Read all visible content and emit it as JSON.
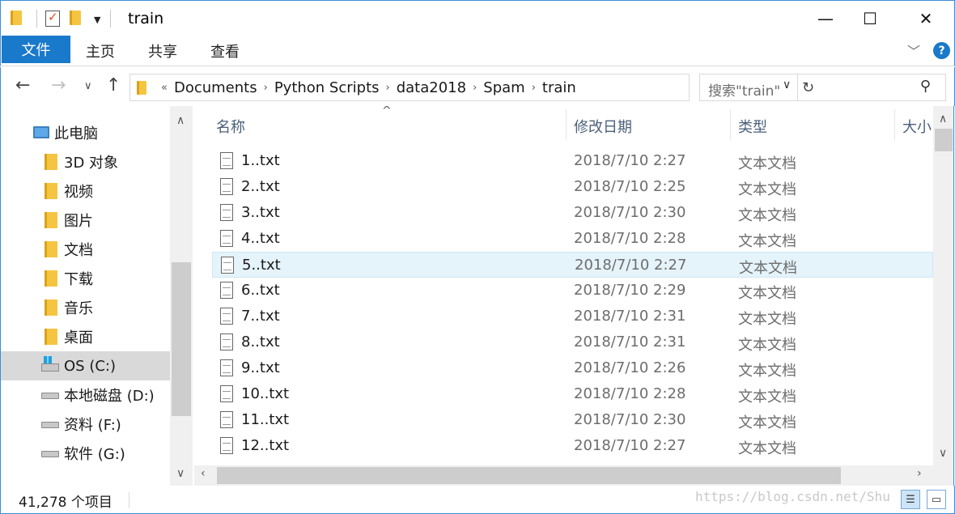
{
  "window": {
    "title": "train",
    "minimize": "—",
    "maximize": "☐",
    "close": "✕"
  },
  "ribbon": {
    "tabs": [
      "文件",
      "主页",
      "共享",
      "查看"
    ]
  },
  "address": {
    "overflow": "«",
    "crumbs": [
      "Documents",
      "Python Scripts",
      "data2018",
      "Spam",
      "train"
    ]
  },
  "search": {
    "placeholder": "搜索\"train\""
  },
  "nav_tree": [
    {
      "label": "此电脑",
      "icon": "computer-icon"
    },
    {
      "label": "3D 对象",
      "icon": "folder-icon"
    },
    {
      "label": "视频",
      "icon": "folder-icon"
    },
    {
      "label": "图片",
      "icon": "folder-icon"
    },
    {
      "label": "文档",
      "icon": "folder-icon"
    },
    {
      "label": "下载",
      "icon": "folder-icon"
    },
    {
      "label": "音乐",
      "icon": "folder-icon"
    },
    {
      "label": "桌面",
      "icon": "folder-icon"
    },
    {
      "label": "OS (C:)",
      "icon": "os-drive-icon",
      "selected": true
    },
    {
      "label": "本地磁盘 (D:)",
      "icon": "drive-icon"
    },
    {
      "label": "资料 (F:)",
      "icon": "drive-icon"
    },
    {
      "label": "软件 (G:)",
      "icon": "drive-icon"
    }
  ],
  "columns": {
    "name": "名称",
    "date": "修改日期",
    "type": "类型",
    "size": "大小"
  },
  "files": [
    {
      "name": "1..txt",
      "date": "2018/7/10 2:27",
      "type": "文本文档"
    },
    {
      "name": "2..txt",
      "date": "2018/7/10 2:25",
      "type": "文本文档"
    },
    {
      "name": "3..txt",
      "date": "2018/7/10 2:30",
      "type": "文本文档"
    },
    {
      "name": "4..txt",
      "date": "2018/7/10 2:28",
      "type": "文本文档"
    },
    {
      "name": "5..txt",
      "date": "2018/7/10 2:27",
      "type": "文本文档",
      "hover": true
    },
    {
      "name": "6..txt",
      "date": "2018/7/10 2:29",
      "type": "文本文档"
    },
    {
      "name": "7..txt",
      "date": "2018/7/10 2:31",
      "type": "文本文档"
    },
    {
      "name": "8..txt",
      "date": "2018/7/10 2:31",
      "type": "文本文档"
    },
    {
      "name": "9..txt",
      "date": "2018/7/10 2:26",
      "type": "文本文档"
    },
    {
      "name": "10..txt",
      "date": "2018/7/10 2:28",
      "type": "文本文档"
    },
    {
      "name": "11..txt",
      "date": "2018/7/10 2:30",
      "type": "文本文档"
    },
    {
      "name": "12..txt",
      "date": "2018/7/10 2:27",
      "type": "文本文档"
    }
  ],
  "status": {
    "count": "41,278 个项目",
    "watermark": "https://blog.csdn.net/Shu"
  },
  "colors": {
    "accent": "#1979ca",
    "border": "#3c8dd9",
    "hover_row": "#e5f3fb"
  }
}
